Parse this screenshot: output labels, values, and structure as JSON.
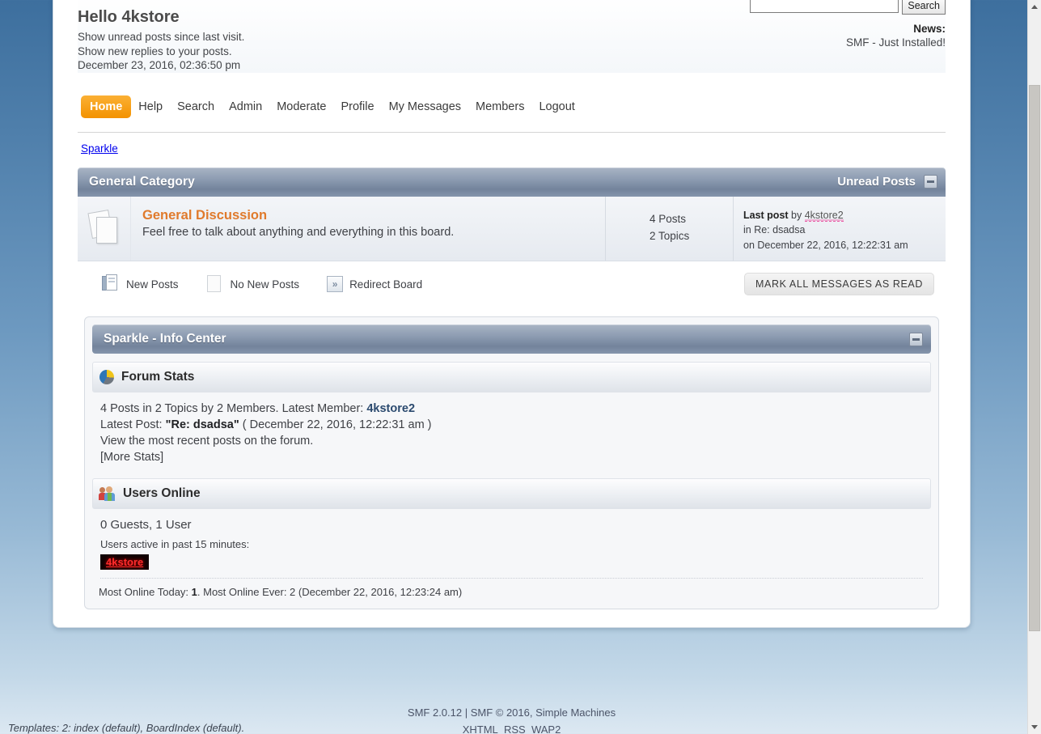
{
  "header": {
    "greeting": "Hello 4kstore",
    "unread_posts_link": "Show unread posts since last visit.",
    "new_replies_link": "Show new replies to your posts.",
    "current_time": "December 23, 2016, 02:36:50 pm",
    "search_value": "",
    "search_placeholder": "",
    "search_button": "Search",
    "news_label": "News:",
    "news_text": "SMF - Just Installed!"
  },
  "menu": [
    {
      "label": "Home",
      "active": true
    },
    {
      "label": "Help",
      "active": false
    },
    {
      "label": "Search",
      "active": false
    },
    {
      "label": "Admin",
      "active": false
    },
    {
      "label": "Moderate",
      "active": false
    },
    {
      "label": "Profile",
      "active": false
    },
    {
      "label": "My Messages",
      "active": false
    },
    {
      "label": "Members",
      "active": false
    },
    {
      "label": "Logout",
      "active": false
    }
  ],
  "breadcrumb": "Sparkle",
  "category": {
    "title": "General Category",
    "unread_label": "Unread Posts",
    "board": {
      "name": "General Discussion",
      "description": "Feel free to talk about anything and everything in this board.",
      "posts": "4 Posts",
      "topics": "2 Topics",
      "last_post_label": "Last post",
      "last_post_by_word": "by",
      "last_post_author": "4kstore2",
      "last_post_subject": "in Re: dsadsa",
      "last_post_date": "on December 22, 2016, 12:22:31 am"
    }
  },
  "legend": [
    {
      "label": "New Posts",
      "icon": "new-posts-icon"
    },
    {
      "label": "No New Posts",
      "icon": "no-new-posts-icon"
    },
    {
      "label": "Redirect Board",
      "icon": "redirect-board-icon"
    }
  ],
  "mark_all_read_button": "MARK ALL MESSAGES AS READ",
  "info_center": {
    "title": "Sparkle - Info Center",
    "forum_stats": {
      "heading": "Forum Stats",
      "icon": "pie-chart-icon",
      "summary_prefix": "4 Posts in 2 Topics by 2 Members. Latest Member: ",
      "latest_member": "4kstore2",
      "latest_post_label": "Latest Post: ",
      "latest_post_title": "\"Re: dsadsa\"",
      "latest_post_date": " ( December 22, 2016, 12:22:31 am )",
      "view_recent": "View the most recent posts on the forum.",
      "more_stats": "[More Stats]"
    },
    "users_online": {
      "heading": "Users Online",
      "icon": "users-icon",
      "counts": "0 Guests, 1 User",
      "active_label": "Users active in past 15 minutes:",
      "online_user": "4kstore",
      "most_online_today_label": "Most Online Today: ",
      "most_online_today_value": "1",
      "most_online_ever": ". Most Online Ever: 2 (December 22, 2016, 12:23:24 am)"
    }
  },
  "footer": {
    "copyright": "SMF 2.0.12 | SMF © 2016, Simple Machines",
    "links": [
      "XHTML",
      "RSS",
      "WAP2"
    ],
    "templates": "Templates: 2: index (default), BoardIndex (default)."
  },
  "colors": {
    "accent_orange": "#f5a01e",
    "board_link": "#e07a2c",
    "category_bar": "#73839b",
    "page_bg_top": "#3d6f9e",
    "online_user_bg": "#120102",
    "online_user_fg": "#ff2d2d"
  }
}
